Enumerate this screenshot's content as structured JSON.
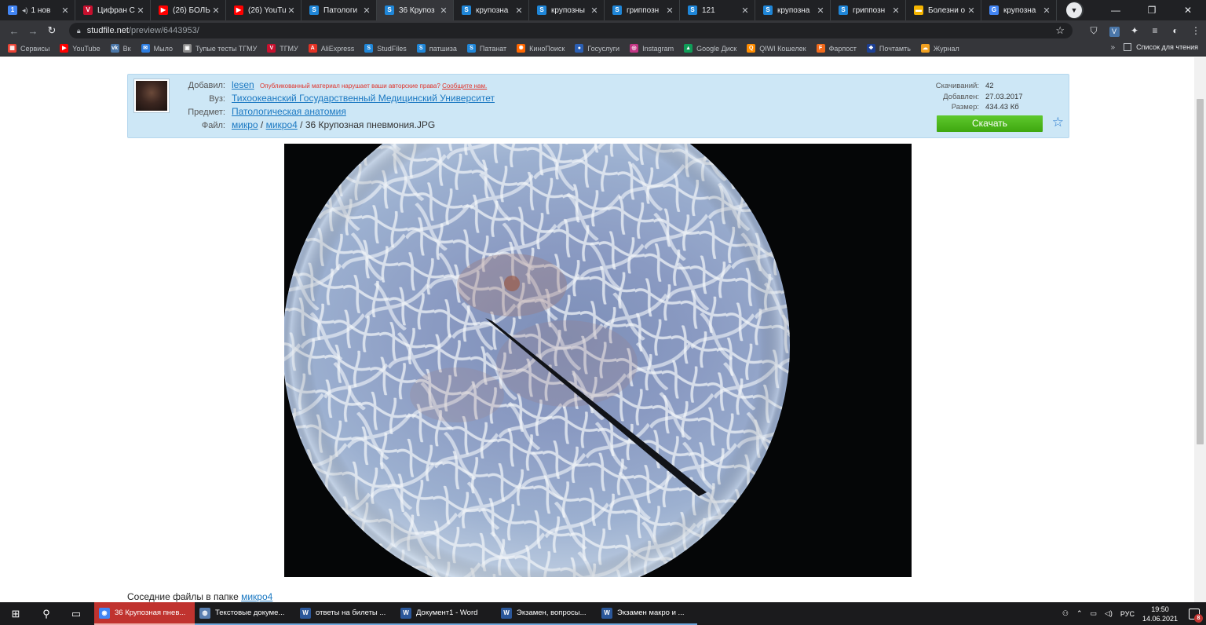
{
  "browser": {
    "tabs": [
      {
        "title": "1 нов",
        "icon": "1",
        "color": "#4285f4",
        "audio": true
      },
      {
        "title": "Цифран С",
        "icon": "V",
        "color": "#c8102e"
      },
      {
        "title": "(26) БОЛЬ",
        "icon": "▶",
        "color": "#ff0000"
      },
      {
        "title": "(26) YouTu",
        "icon": "▶",
        "color": "#ff0000"
      },
      {
        "title": "Патологи",
        "icon": "S",
        "color": "#1f86d8"
      },
      {
        "title": "36 Крупоз",
        "icon": "S",
        "color": "#1f86d8",
        "active": true
      },
      {
        "title": "крупозна",
        "icon": "S",
        "color": "#1f86d8"
      },
      {
        "title": "крупозны",
        "icon": "S",
        "color": "#1f86d8"
      },
      {
        "title": "гриппозн",
        "icon": "S",
        "color": "#1f86d8"
      },
      {
        "title": "121",
        "icon": "S",
        "color": "#1f86d8"
      },
      {
        "title": "крупозна",
        "icon": "S",
        "color": "#1f86d8"
      },
      {
        "title": "гриппозн",
        "icon": "S",
        "color": "#1f86d8"
      },
      {
        "title": "Болезни о",
        "icon": "▬",
        "color": "#f4b400"
      },
      {
        "title": "крупозна",
        "icon": "G",
        "color": "#4285f4"
      }
    ],
    "url_host": "studfile.net",
    "url_path": "/preview/6443953/",
    "bookmarks": [
      {
        "label": "Сервисы",
        "icon": "▦",
        "color": "#ea4335"
      },
      {
        "label": "YouTube",
        "icon": "▶",
        "color": "#ff0000"
      },
      {
        "label": "Вк",
        "icon": "vk",
        "color": "#4a76a8"
      },
      {
        "label": "Мыло",
        "icon": "✉",
        "color": "#2d7de0"
      },
      {
        "label": "Тупые тесты ТГМУ",
        "icon": "▣",
        "color": "#8a8a8a"
      },
      {
        "label": "ТГМУ",
        "icon": "V",
        "color": "#c8102e"
      },
      {
        "label": "AliExpress",
        "icon": "A",
        "color": "#e43225"
      },
      {
        "label": "StudFiles",
        "icon": "S",
        "color": "#1f86d8"
      },
      {
        "label": "патшиза",
        "icon": "S",
        "color": "#1f86d8"
      },
      {
        "label": "Патанат",
        "icon": "S",
        "color": "#1f86d8"
      },
      {
        "label": "КиноПоиск",
        "icon": "✺",
        "color": "#ff6600"
      },
      {
        "label": "Госуслуги",
        "icon": "●",
        "color": "#2b5fb4"
      },
      {
        "label": "Instagram",
        "icon": "◎",
        "color": "#c13584"
      },
      {
        "label": "Google Диск",
        "icon": "▲",
        "color": "#0f9d58"
      },
      {
        "label": "QIWI Кошелек",
        "icon": "Q",
        "color": "#ff8c00"
      },
      {
        "label": "Фарпост",
        "icon": "F",
        "color": "#f26a1b"
      },
      {
        "label": "Почтамть",
        "icon": "❖",
        "color": "#1c3f94"
      },
      {
        "label": "Журнал",
        "icon": "☁",
        "color": "#f0a020"
      }
    ],
    "bookmarks_more": "»",
    "reading_list": "Список для чтения"
  },
  "file_info": {
    "added_by_label": "Добавил:",
    "added_by": "lesen",
    "copyright_notice": "Опубликованный материал нарушает ваши авторские права?",
    "copyright_link": "Сообщите нам.",
    "university_label": "Вуз:",
    "university": "Тихоокеанский Государственный Медицинский Университет",
    "subject_label": "Предмет:",
    "subject": "Патологическая анатомия",
    "file_label": "Файл:",
    "path_1": "микро",
    "path_sep_1": "/",
    "path_2": "микро4",
    "path_sep_2": "/",
    "file_name": "36 Крупозная пневмония.JPG",
    "downloads_label": "Скачиваний:",
    "downloads": "42",
    "added_label": "Добавлен:",
    "added_date": "27.03.2017",
    "size_label": "Размер:",
    "size": "434.43 Кб",
    "download_button": "Скачать"
  },
  "neighbors": {
    "label": "Соседние файлы в папке",
    "folder": "микро4"
  },
  "taskbar": {
    "tasks": [
      {
        "title": "36 Крупозная пнев...",
        "icon": "◉",
        "color": "#4285f4",
        "active": true
      },
      {
        "title": "Текстовые докуме...",
        "icon": "◍",
        "color": "#5a7fb0"
      },
      {
        "title": "ответы на билеты ...",
        "icon": "W",
        "color": "#2b579a"
      },
      {
        "title": "Документ1 - Word",
        "icon": "W",
        "color": "#2b579a"
      },
      {
        "title": "Экзамен, вопросы...",
        "icon": "W",
        "color": "#2b579a"
      },
      {
        "title": "Экзамен макро и ...",
        "icon": "W",
        "color": "#2b579a"
      }
    ],
    "lang": "РУС",
    "time": "19:50",
    "date": "14.06.2021",
    "notifications": "8"
  }
}
